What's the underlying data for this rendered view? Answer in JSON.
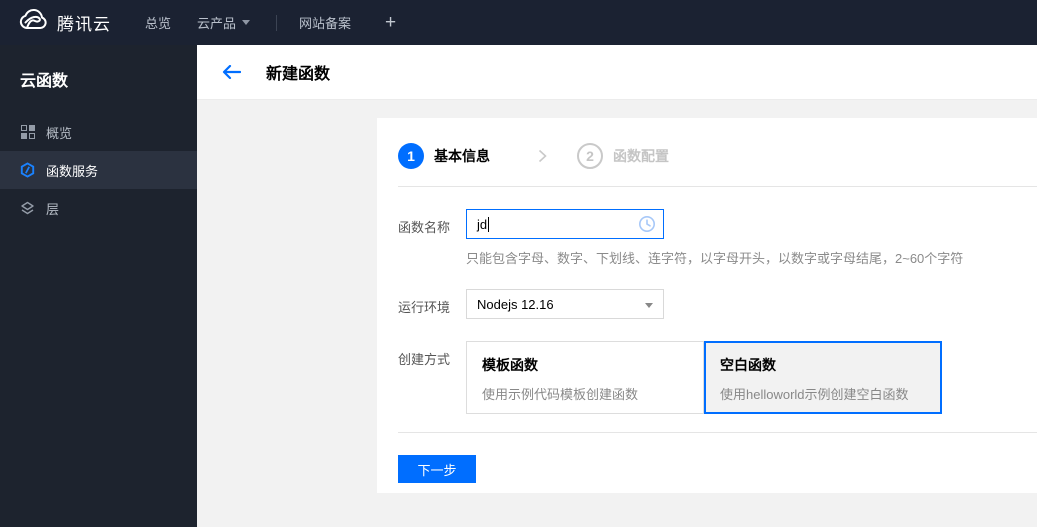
{
  "topbar": {
    "brand": "腾讯云",
    "nav": [
      {
        "label": "总览"
      },
      {
        "label": "云产品",
        "caret_icon": "caret-down-icon"
      },
      {
        "label": "网站备案"
      }
    ],
    "plus_label": "+"
  },
  "sidebar": {
    "title": "云函数",
    "items": [
      {
        "label": "概览",
        "icon": "grid-icon",
        "selected": false
      },
      {
        "label": "函数服务",
        "icon": "scf-hexagon-icon",
        "selected": true
      },
      {
        "label": "层",
        "icon": "layers-icon",
        "selected": false
      }
    ]
  },
  "header": {
    "back_icon": "back-arrow-icon",
    "title": "新建函数"
  },
  "wizard": {
    "steps": [
      {
        "num": "1",
        "label": "基本信息",
        "active": true
      },
      {
        "num": "2",
        "label": "函数配置",
        "active": false
      }
    ]
  },
  "form": {
    "name": {
      "label": "函数名称",
      "value": "jd",
      "status_icon": "clock-icon",
      "hint": "只能包含字母、数字、下划线、连字符，以字母开头，以数字或字母结尾，2~60个字符"
    },
    "runtime": {
      "label": "运行环境",
      "value": "Nodejs 12.16"
    },
    "method": {
      "label": "创建方式",
      "options": [
        {
          "title": "模板函数",
          "desc": "使用示例代码模板创建函数",
          "selected": false
        },
        {
          "title": "空白函数",
          "desc": "使用helloworld示例创建空白函数",
          "selected": true
        }
      ]
    },
    "next_label": "下一步"
  },
  "colors": {
    "accent": "#006eff",
    "topbar_bg": "#1b2232",
    "sidebar_bg": "#1d232e",
    "sidebar_selected_bg": "#2b3240",
    "content_bg": "#f2f2f2"
  }
}
